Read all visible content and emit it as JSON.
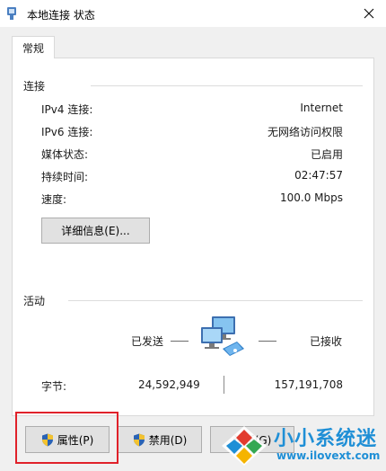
{
  "window": {
    "title": "本地连接 状态",
    "icon": "network-adapter-icon",
    "close_icon": "close-icon"
  },
  "tabs": [
    {
      "label": "常规"
    }
  ],
  "connection": {
    "group_label": "连接",
    "rows": [
      {
        "label": "IPv4 连接:",
        "value": "Internet"
      },
      {
        "label": "IPv6 连接:",
        "value": "无网络访问权限"
      },
      {
        "label": "媒体状态:",
        "value": "已启用"
      },
      {
        "label": "持续时间:",
        "value": "02:47:57"
      },
      {
        "label": "速度:",
        "value": "100.0 Mbps"
      }
    ],
    "details_button": "详细信息(E)..."
  },
  "activity": {
    "group_label": "活动",
    "sent_label": "已发送",
    "received_label": "已接收",
    "bytes_label": "字节:",
    "bytes_sent": "24,592,949",
    "bytes_received": "157,191,708",
    "icon": "network-activity-icon"
  },
  "buttons": {
    "properties": "属性(P)",
    "disable": "禁用(D)",
    "diagnose": "诊断(G)"
  },
  "watermark": {
    "name": "小小系统迷",
    "url": "www.ilovext.com"
  },
  "colors": {
    "highlight": "#e0212a",
    "watermark": "#1f8fd6",
    "shield_blue": "#2a63b5",
    "shield_yellow": "#f2c230"
  }
}
